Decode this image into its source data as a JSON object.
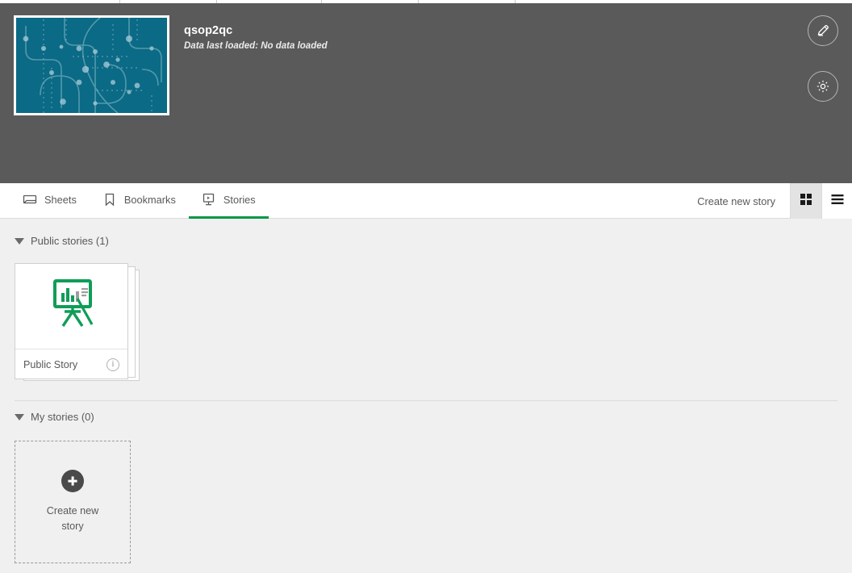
{
  "colors": {
    "header_bg": "#5a5a5a",
    "content_bg": "#f0f0f0",
    "accent_green": "#009845",
    "thumb_teal": "#0b6a85",
    "text_gray": "#595959"
  },
  "app_header": {
    "title": "qsop2qc",
    "subtitle": "Data last loaded: No data loaded",
    "thumbnail_name": "app-thumbnail-circuit-pattern",
    "edit_button": "edit-icon",
    "settings_button": "gear-icon"
  },
  "toolbar": {
    "tabs": [
      {
        "label": "Sheets",
        "icon": "sheet-icon",
        "active": false
      },
      {
        "label": "Bookmarks",
        "icon": "bookmark-icon",
        "active": false
      },
      {
        "label": "Stories",
        "icon": "story-play-icon",
        "active": true
      }
    ],
    "create_new_story_label": "Create new story",
    "view_modes": [
      {
        "name": "grid-view",
        "icon": "grid-icon",
        "active": true
      },
      {
        "name": "list-view",
        "icon": "list-icon",
        "active": false
      }
    ]
  },
  "content": {
    "sections": [
      {
        "title": "Public stories (1)",
        "expanded": true,
        "stories": [
          {
            "name": "Public Story",
            "icon": "story-easel-icon",
            "info_icon": "info-icon"
          }
        ]
      },
      {
        "title": "My stories (0)",
        "expanded": true,
        "stories": []
      }
    ],
    "create_card": {
      "label": "Create new story",
      "icon": "plus-circle-icon"
    }
  }
}
